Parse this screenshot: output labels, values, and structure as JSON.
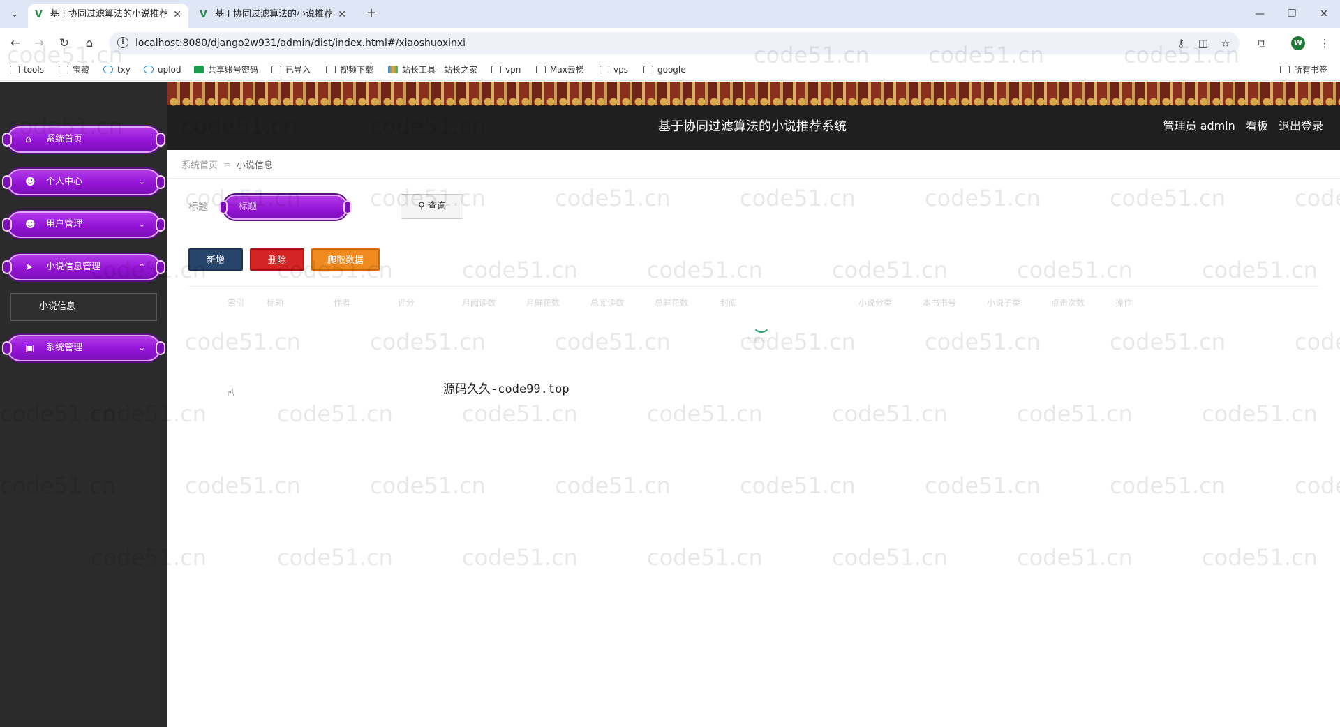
{
  "browser": {
    "tabs": [
      {
        "title": "基于协同过滤算法的小说推荐系",
        "close": "✕",
        "active": true
      },
      {
        "title": "基于协同过滤算法的小说推荐系",
        "close": "✕",
        "active": false
      }
    ],
    "new_tab": "+",
    "url": "localhost:8080/django2w931/admin/dist/index.html#/xiaoshuoxinxi",
    "profile_initial": "W",
    "bookmarks": [
      "tools",
      "宝藏",
      "txy",
      "uplod",
      "共享账号密码",
      "已导入",
      "视频下载",
      "站长工具 - 站长之家",
      "vpn",
      "Max云梯",
      "vps",
      "google"
    ],
    "all_bookmarks": "所有书签"
  },
  "header": {
    "title": "基于协同过滤算法的小说推荐系统",
    "role": "管理员 admin",
    "board": "看板",
    "logout": "退出登录"
  },
  "sidebar": {
    "items": [
      {
        "label": "系统首页",
        "icon": "home-icon"
      },
      {
        "label": "个人中心",
        "icon": "user-icon"
      },
      {
        "label": "用户管理",
        "icon": "user-icon"
      },
      {
        "label": "小说信息管理",
        "icon": "send-icon"
      },
      {
        "label": "系统管理",
        "icon": "briefcase-icon"
      }
    ],
    "subitem": "小说信息"
  },
  "breadcrumb": {
    "home": "系统首页",
    "separator": "≡",
    "current": "小说信息"
  },
  "filter": {
    "label": "标题",
    "placeholder": "标题",
    "search": "查询"
  },
  "actions": {
    "add": "新增",
    "delete": "删除",
    "crawl": "爬取数据"
  },
  "table": {
    "columns": [
      "索引",
      "标题",
      "作者",
      "评分",
      "月阅读数",
      "月鲜花数",
      "总阅读数",
      "总鲜花数",
      "封面",
      "小说分类",
      "本书书号",
      "小说子类",
      "点击次数",
      "操作"
    ],
    "loading_text": "加载中"
  },
  "overlay_text": "源码久久-code99.top",
  "watermark": "code51.cn",
  "colors": {
    "accent_purple": "#9414d6",
    "add": "#27446b",
    "delete": "#d42424",
    "crawl": "#ee8a1f",
    "sidebar_bg": "#2b2b2b"
  }
}
